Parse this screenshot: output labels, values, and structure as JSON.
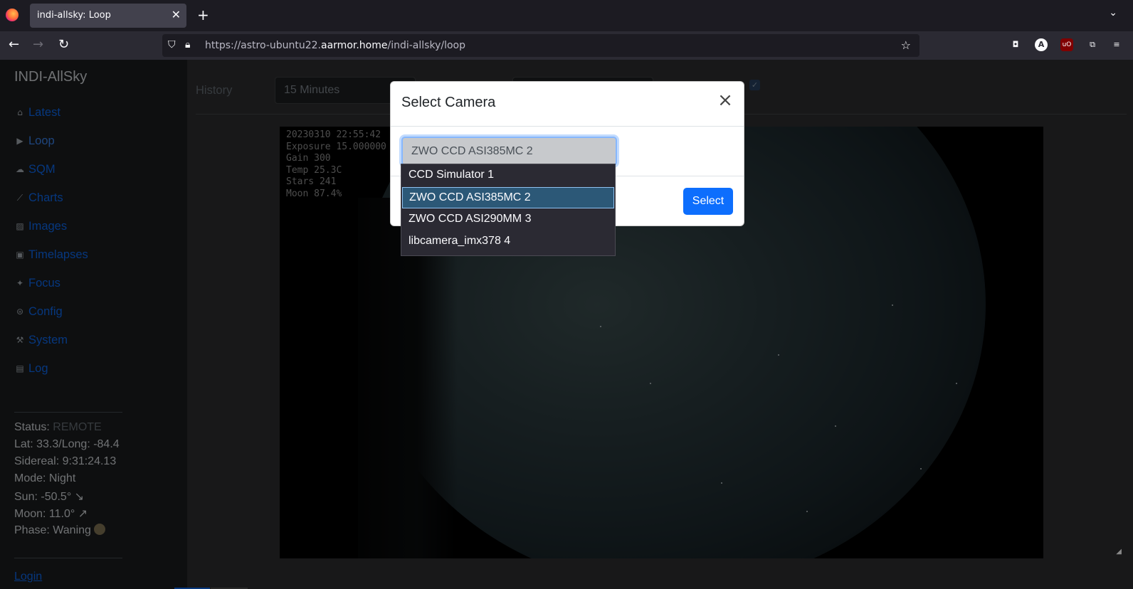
{
  "browser": {
    "tab_title": "indi-allsky: Loop",
    "tab_close": "✕",
    "new_tab": "+",
    "tab_list": "⌄",
    "url_prefix": "https://astro-ubuntu22.",
    "url_domain": "aarmor.home",
    "url_path": "/indi-allsky/loop"
  },
  "sidebar": {
    "brand": "INDI-AllSky",
    "items": [
      {
        "label": "Latest",
        "icon": "home-icon"
      },
      {
        "label": "Loop",
        "icon": "play-icon"
      },
      {
        "label": "SQM",
        "icon": "cloud-moon-icon"
      },
      {
        "label": "Charts",
        "icon": "chart-line-icon"
      },
      {
        "label": "Images",
        "icon": "image-icon"
      },
      {
        "label": "Timelapses",
        "icon": "video-icon"
      },
      {
        "label": "Focus",
        "icon": "sparkles-icon"
      },
      {
        "label": "Config",
        "icon": "toggle-icon"
      },
      {
        "label": "System",
        "icon": "wrench-icon"
      },
      {
        "label": "Log",
        "icon": "terminal-icon"
      }
    ],
    "status_label": "Status:",
    "status_value": "REMOTE",
    "lat_long": "Lat: 33.3/Long: -84.4",
    "sidereal": "Sidereal: 9:31:24.13",
    "mode": "Mode: Night",
    "sun": "Sun: -50.5° ↘",
    "moon": "Moon: 11.0° ↗",
    "phase": "Phase: Waning",
    "login": "Login"
  },
  "main": {
    "history_label": "History",
    "history_value": "15 Minutes",
    "overlay": {
      "timestamp": "20230310 22:55:42",
      "exposure": "Exposure 15.000000",
      "gain": "Gain 300",
      "temp": "Temp 25.3C",
      "stars": "Stars 241",
      "moon": "Moon 87.4%"
    }
  },
  "modal": {
    "title": "Select Camera",
    "selected_value": "ZWO CCD ASI385MC 2",
    "button_label": "Select",
    "options": [
      "CCD Simulator 1",
      "ZWO CCD ASI385MC 2",
      "ZWO CCD ASI290MM 3",
      "libcamera_imx378 4"
    ],
    "highlighted_index": 1
  },
  "colors": {
    "accent": "#0d6efd",
    "sidebar_bg": "#1d1f21",
    "page_bg": "#303132"
  }
}
